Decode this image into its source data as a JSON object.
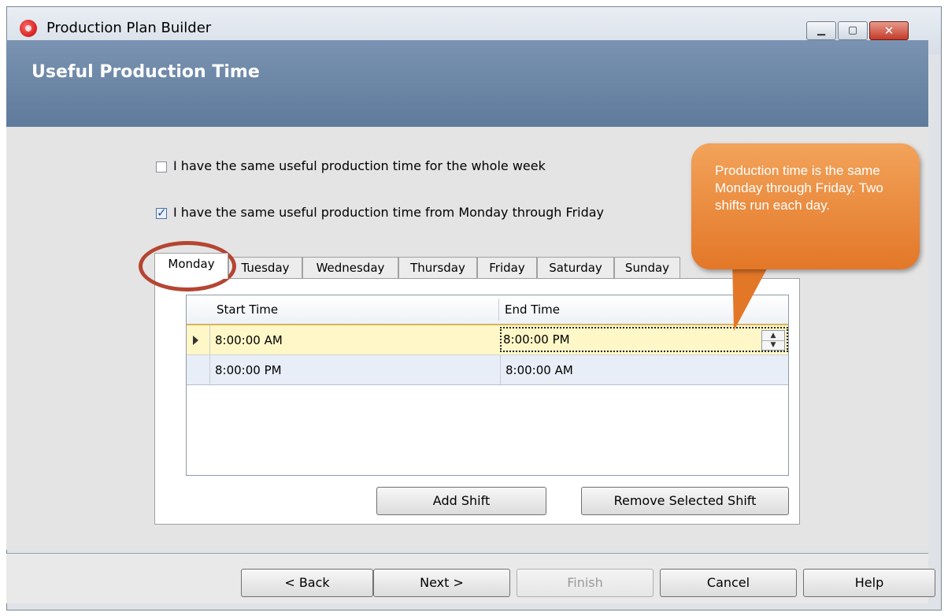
{
  "window": {
    "title": "Production Plan Builder",
    "controls": {
      "minimize": "▁",
      "maximize": "▢",
      "close": "✕"
    }
  },
  "header": {
    "title": "Useful Production Time"
  },
  "options": [
    {
      "label": "I have the same useful production time for the whole week",
      "checked": false
    },
    {
      "label": "I have the same useful production time from Monday through Friday",
      "checked": true
    }
  ],
  "tabs": [
    "Monday",
    "Tuesday",
    "Wednesday",
    "Thursday",
    "Friday",
    "Saturday",
    "Sunday"
  ],
  "active_tab": "Monday",
  "grid": {
    "columns": [
      "Start Time",
      "End Time"
    ],
    "rows": [
      {
        "start": "8:00:00 AM",
        "end": "8:00:00 PM"
      },
      {
        "start": "8:00:00 PM",
        "end": "8:00:00 AM"
      }
    ]
  },
  "panel_buttons": {
    "add_shift": "Add Shift",
    "remove_shift": "Remove Selected Shift"
  },
  "footer_buttons": {
    "back": "< Back",
    "next": "Next >",
    "finish": "Finish",
    "cancel": "Cancel",
    "help": "Help"
  },
  "callout": {
    "text": "Production time is the same Monday through Friday. Two shifts run each day."
  },
  "colors": {
    "header": "#6b84a3",
    "callout": "#e8873a",
    "highlight_ring": "#b54532",
    "selected_row": "#fff7c7"
  }
}
